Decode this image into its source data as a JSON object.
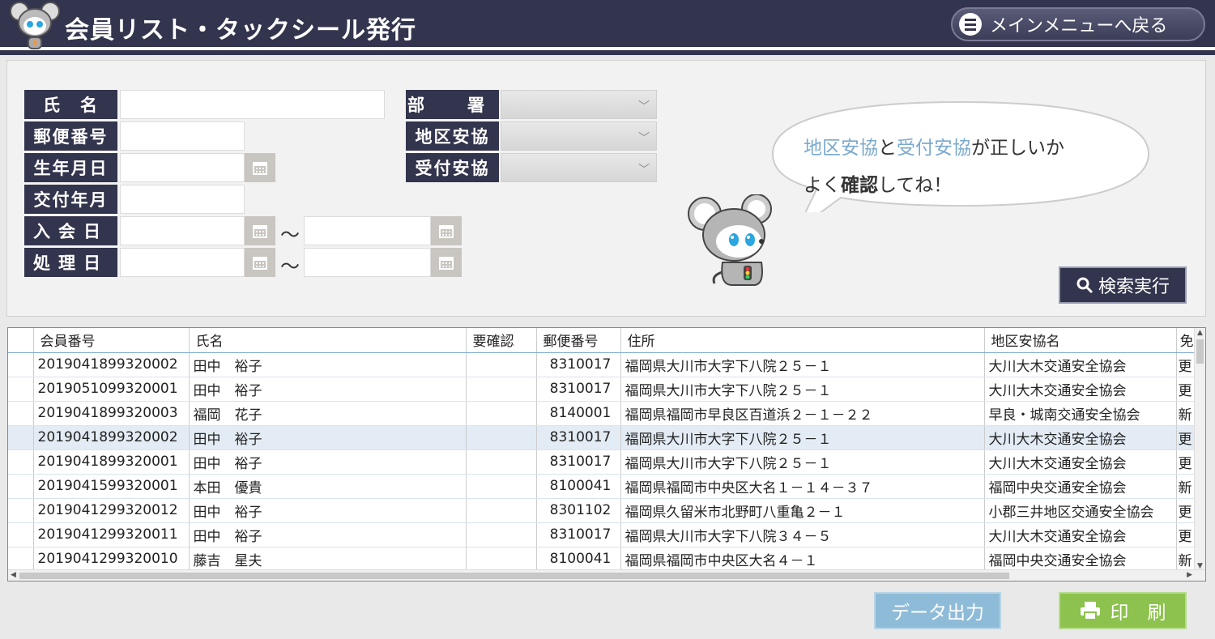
{
  "header": {
    "title": "会員リスト・タックシール発行",
    "menu_label": "メインメニューへ戻る"
  },
  "form": {
    "name_label": "氏　名",
    "postal_label": "郵便番号",
    "birth_label": "生年月日",
    "issue_label": "交付年月",
    "join_label": "入会日",
    "process_label": "処理日",
    "dept_label": "部　署",
    "district_label": "地区安協",
    "reception_label": "受付安協",
    "range_sep": "〜"
  },
  "bubble": {
    "hl1": "地区安協",
    "t1": "と",
    "hl2": "受付安協",
    "t2": "が正しいか",
    "l2a": "よく",
    "l2b": "確認",
    "l2c": "してね！"
  },
  "buttons": {
    "search": "検索実行",
    "data_export": "データ出力",
    "print": "印　刷"
  },
  "table": {
    "columns": [
      "会員番号",
      "氏名",
      "要確認",
      "郵便番号",
      "住所",
      "地区安協名",
      "免"
    ],
    "rows": [
      [
        "2019041899320002",
        "田中　裕子",
        "",
        "8310017",
        "福岡県大川市大字下八院２５－１",
        "大川大木交通安全協会",
        "更"
      ],
      [
        "2019051099320001",
        "田中　裕子",
        "",
        "8310017",
        "福岡県大川市大字下八院２５－１",
        "大川大木交通安全協会",
        "更"
      ],
      [
        "2019041899320003",
        "福岡　花子",
        "",
        "8140001",
        "福岡県福岡市早良区百道浜２－１－２２",
        "早良・城南交通安全協会",
        "新"
      ],
      [
        "2019041899320002",
        "田中　裕子",
        "",
        "8310017",
        "福岡県大川市大字下八院２５－１",
        "大川大木交通安全協会",
        "更"
      ],
      [
        "2019041899320001",
        "田中　裕子",
        "",
        "8310017",
        "福岡県大川市大字下八院２５－１",
        "大川大木交通安全協会",
        "更"
      ],
      [
        "2019041599320001",
        "本田　優貴",
        "",
        "8100041",
        "福岡県福岡市中央区大名１－１４－３７",
        "福岡中央交通安全協会",
        "新"
      ],
      [
        "2019041299320012",
        "田中　裕子",
        "",
        "8301102",
        "福岡県久留米市北野町八重亀２－１",
        "小郡三井地区交通安全協会",
        "更"
      ],
      [
        "2019041299320011",
        "田中　裕子",
        "",
        "8310017",
        "福岡県大川市大字下八院３４－５",
        "大川大木交通安全協会",
        "更"
      ],
      [
        "2019041299320010",
        "藤吉　星夫",
        "",
        "8100041",
        "福岡県福岡市中央区大名４－１",
        "福岡中央交通安全協会",
        "新"
      ]
    ],
    "selected_row": 3
  }
}
